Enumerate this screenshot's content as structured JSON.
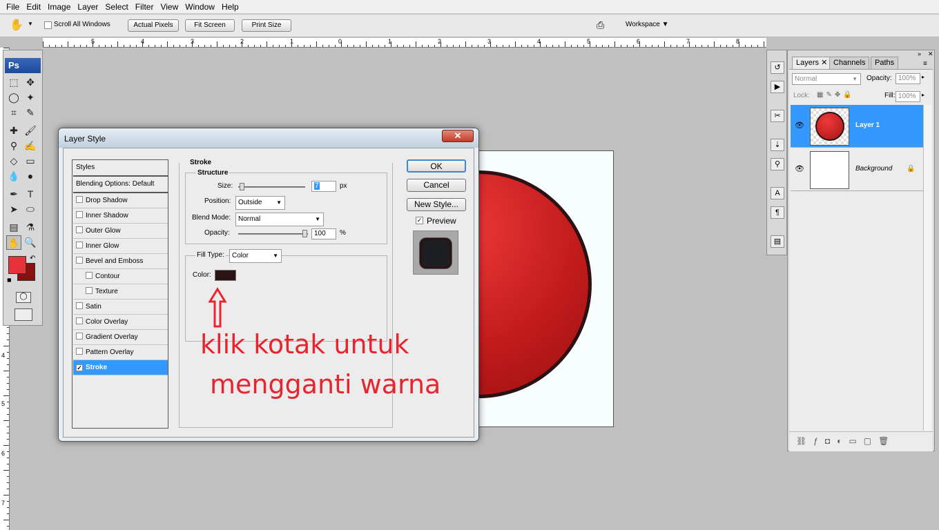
{
  "menu": [
    "File",
    "Edit",
    "Image",
    "Layer",
    "Select",
    "Filter",
    "View",
    "Window",
    "Help"
  ],
  "options": {
    "scroll_all": "Scroll All Windows",
    "actual_pixels": "Actual Pixels",
    "fit_screen": "Fit Screen",
    "print_size": "Print Size",
    "workspace": "Workspace"
  },
  "toolbox": {
    "logo": "Ps"
  },
  "ruler_top": [
    "5",
    "4",
    "3",
    "2",
    "1",
    "0",
    "1",
    "2",
    "3",
    "4",
    "5",
    "6",
    "7",
    "8"
  ],
  "ruler_left": [
    "4",
    "5",
    "6",
    "7"
  ],
  "dialog": {
    "title": "Layer Style",
    "styles_header": "Styles",
    "blending": "Blending Options: Default",
    "items": [
      {
        "label": "Drop Shadow",
        "checked": false
      },
      {
        "label": "Inner Shadow",
        "checked": false
      },
      {
        "label": "Outer Glow",
        "checked": false
      },
      {
        "label": "Inner Glow",
        "checked": false
      },
      {
        "label": "Bevel and Emboss",
        "checked": false
      },
      {
        "label": "Contour",
        "checked": false
      },
      {
        "label": "Texture",
        "checked": false
      },
      {
        "label": "Satin",
        "checked": false
      },
      {
        "label": "Color Overlay",
        "checked": false
      },
      {
        "label": "Gradient Overlay",
        "checked": false
      },
      {
        "label": "Pattern Overlay",
        "checked": false
      },
      {
        "label": "Stroke",
        "checked": true
      }
    ],
    "stroke": {
      "title": "Stroke",
      "structure": "Structure",
      "size_label": "Size:",
      "size_value": "7",
      "size_unit": "px",
      "position_label": "Position:",
      "position_value": "Outside",
      "blend_label": "Blend Mode:",
      "blend_value": "Normal",
      "opacity_label": "Opacity:",
      "opacity_value": "100",
      "opacity_unit": "%",
      "fill_type_label": "Fill Type:",
      "fill_type_value": "Color",
      "color_label": "Color:",
      "color_value": "#2a1215"
    },
    "ok": "OK",
    "cancel": "Cancel",
    "new_style": "New Style...",
    "preview": "Preview"
  },
  "layers_panel": {
    "tabs": [
      "Layers",
      "Channels",
      "Paths"
    ],
    "blend_mode": "Normal",
    "opacity_label": "Opacity:",
    "opacity_value": "100%",
    "lock_label": "Lock:",
    "fill_label": "Fill:",
    "fill_value": "100%",
    "layers": [
      {
        "name": "Layer 1",
        "selected": true
      },
      {
        "name": "Background",
        "selected": false
      }
    ]
  },
  "annotation": {
    "line1": "klik kotak untuk",
    "line2": "mengganti warna",
    "color": "#e8242f"
  },
  "colors": {
    "foreground": "#e8323a",
    "background": "#8a1010",
    "accent": "#3399ff"
  }
}
